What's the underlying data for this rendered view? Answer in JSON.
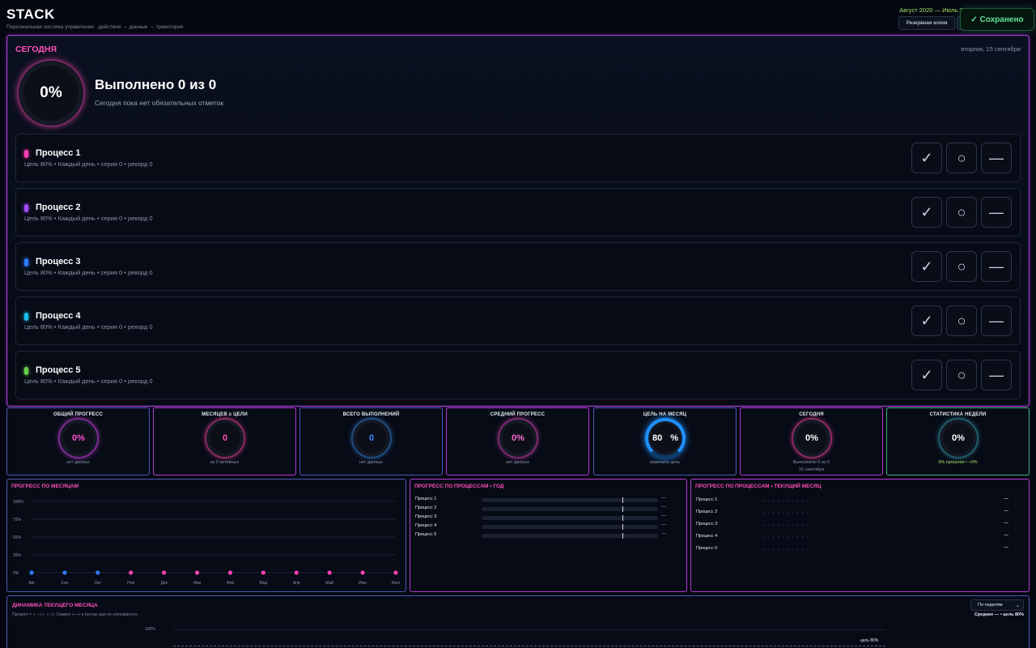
{
  "app": {
    "logo": "STACK",
    "tagline": "Персональная система управления · действия → данные → траектория",
    "period": "Август 2020 — Июль 2021",
    "backup_label": "Резервная копия",
    "saved_label": "✓ Сохранено"
  },
  "today": {
    "title": "СЕГОДНЯ",
    "date": "вторник, 15 сентября",
    "percent": "0%",
    "done_title": "Выполнено 0 из 0",
    "done_sub": "Сегодня пока нет обязательных отметок",
    "processes": [
      {
        "name": "Процесс 1",
        "meta": "Цель 80% • Каждый день • серия 0 • рекорд 0",
        "color": "#ff3fb5"
      },
      {
        "name": "Процесс 2",
        "meta": "Цель 80% • Каждый день • серия 0 • рекорд 0",
        "color": "#a04bff"
      },
      {
        "name": "Процесс 3",
        "meta": "Цель 80% • Каждый день • серия 0 • рекорд 0",
        "color": "#2f7bff"
      },
      {
        "name": "Процесс 4",
        "meta": "Цель 80% • Каждый день • серия 0 • рекорд 0",
        "color": "#18c1f0"
      },
      {
        "name": "Процесс 5",
        "meta": "Цель 80% • Каждый день • серия 0 • рекорд 0",
        "color": "#6ad04a"
      }
    ],
    "mark_done": "✓",
    "mark_skip": "○",
    "mark_na": "—"
  },
  "stats": [
    {
      "title": "ОБЩИЙ ПРОГРЕСС",
      "value": "0%",
      "sub": "нет данных",
      "sub2": "",
      "color": "#ff4fd8",
      "ring": "#7a2a8f",
      "border": "#4a5ab8"
    },
    {
      "title": "МЕСЯЦЕВ ≥ ЦЕЛИ",
      "value": "0",
      "sub": "из 0 активных",
      "sub2": "",
      "color": "#ff4fb8",
      "ring": "#8a2a62",
      "border": "#b43bd6"
    },
    {
      "title": "ВСЕГО ВЫПОЛНЕНИЙ",
      "value": "0",
      "sub": "нет данных",
      "sub2": "",
      "color": "#2f8bff",
      "ring": "#1f4c80",
      "border": "#4a5ab8"
    },
    {
      "title": "СРЕДНИЙ ПРОГРЕСС",
      "value": "0%",
      "sub": "нет данных",
      "sub2": "",
      "color": "#ff6ad6",
      "ring": "#7a2a6f",
      "border": "#b43bd6"
    },
    {
      "title": "ЦЕЛЬ НА МЕСЯЦ",
      "value": "80",
      "unit": "%",
      "sub": "изменить цель",
      "sub2": "",
      "color": "#ffffff",
      "ring": "#1e90ff",
      "border": "#4a5ab8"
    },
    {
      "title": "СЕГОДНЯ",
      "value": "0%",
      "sub": "Выполнено 0 из 0",
      "sub2": "15 сентября",
      "color": "#ffffff",
      "ring": "#8a2a62",
      "border": "#b43bd6"
    },
    {
      "title": "СТАТИСТИКА НЕДЕЛИ",
      "value": "0%",
      "sub": "0% прошлая • +0%",
      "sub2": "",
      "color": "#ffffff",
      "ring": "#1f5a66",
      "border": "#3fb58a",
      "sub_color": "#a7e06a"
    }
  ],
  "monthly": {
    "title": "ПРОГРЕСС ПО МЕСЯЦАМ",
    "chart_data": {
      "type": "line",
      "categories": [
        "Авг",
        "Сен",
        "Окт",
        "Ноя",
        "Дек",
        "Янв",
        "Фев",
        "Мар",
        "Апр",
        "Май",
        "Июн",
        "Июл"
      ],
      "values": [
        0,
        0,
        0,
        0,
        0,
        0,
        0,
        0,
        0,
        0,
        0,
        0
      ],
      "point_colors": [
        "#2f7bff",
        "#2f7bff",
        "#2f7bff",
        "#ff3fb5",
        "#ff3fb5",
        "#ff3fb5",
        "#ff3fb5",
        "#ff3fb5",
        "#ff3fb5",
        "#ff3fb5",
        "#ff3fb5",
        "#ff3fb5"
      ],
      "yticks": [
        "100%",
        "75%",
        "50%",
        "25%",
        "0%"
      ],
      "ylim": [
        0,
        100
      ],
      "grid": true
    }
  },
  "year": {
    "title": "ПРОГРЕСС ПО ПРОЦЕССАМ • ГОД",
    "rows": [
      {
        "label": "Процесс 1",
        "value": "—"
      },
      {
        "label": "Процесс 2",
        "value": "—"
      },
      {
        "label": "Процесс 3",
        "value": "—"
      },
      {
        "label": "Процесс 4",
        "value": "—"
      },
      {
        "label": "Процесс 5",
        "value": "—"
      }
    ]
  },
  "current_month": {
    "title": "ПРОГРЕСС ПО ПРОЦЕССАМ • ТЕКУЩИЙ МЕСЯЦ",
    "rows": [
      {
        "label": "Процесс 1",
        "value": "—"
      },
      {
        "label": "Процесс 2",
        "value": "—"
      },
      {
        "label": "Процесс 3",
        "value": "—"
      },
      {
        "label": "Процесс 4",
        "value": "—"
      },
      {
        "label": "Процесс 5",
        "value": "—"
      }
    ]
  },
  "dynamics": {
    "title": "ДИНАМИКА ТЕКУЩЕГО МЕСЯЦА",
    "note": "Процент = ✓ ÷ (✓ + ○). Символ «—» и пустые дни не учитываются.",
    "select_value": "По неделям",
    "average": "Среднее — • цель 80%",
    "y_top": "100%",
    "goal_label": "цель 80%"
  }
}
